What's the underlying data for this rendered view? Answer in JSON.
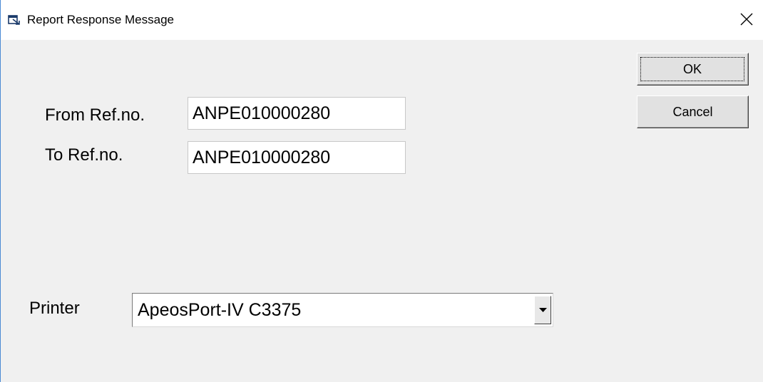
{
  "window": {
    "title": "Report Response Message",
    "icon": "window-app-icon",
    "close_icon": "close-icon"
  },
  "form": {
    "from_label": "From Ref.no.",
    "from_value": "ANPE010000280",
    "to_label": "To Ref.no.",
    "to_value": "ANPE010000280",
    "printer_label": "Printer",
    "printer_value": "ApeosPort-IV C3375"
  },
  "buttons": {
    "ok_label": "OK",
    "cancel_label": "Cancel"
  },
  "colors": {
    "dialog_bg": "#f0f0f0",
    "titlebar_bg": "#ffffff",
    "window_border": "#4a8ad4"
  }
}
